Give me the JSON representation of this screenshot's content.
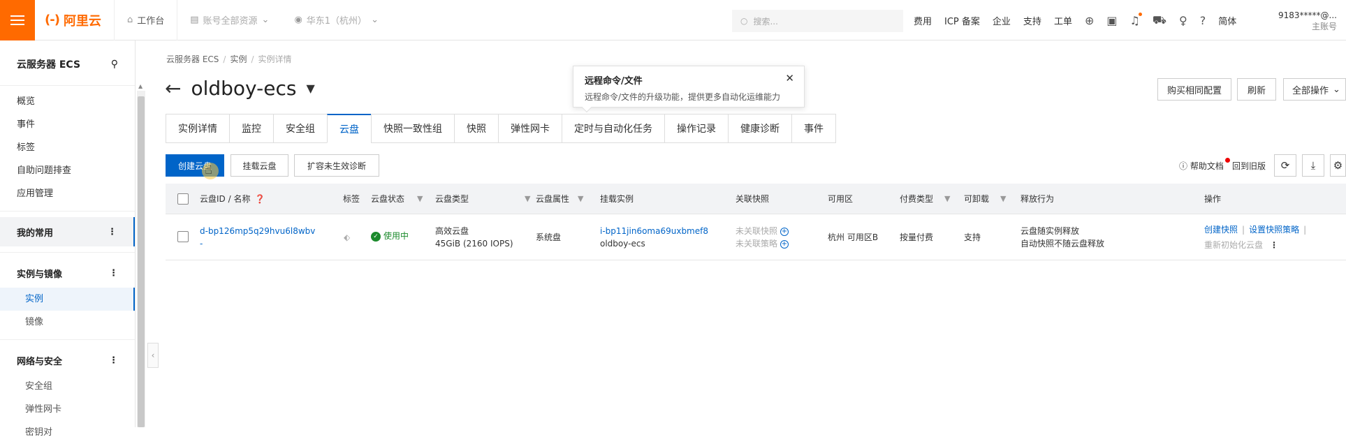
{
  "topbar": {
    "logo_text": "阿里云",
    "workbench": "工作台",
    "account_scope": "账号全部资源",
    "region": "华东1（杭州）",
    "search_placeholder": "搜索...",
    "nav": [
      "费用",
      "ICP 备案",
      "企业",
      "支持",
      "工单"
    ],
    "lang": "简体",
    "account_id": "9183*****@...",
    "account_role": "主账号"
  },
  "sidebar": {
    "title": "云服务器 ECS",
    "top_items": [
      "概览",
      "事件",
      "标签",
      "自助问题排查",
      "应用管理"
    ],
    "groups": [
      {
        "label": "我的常用",
        "items": []
      },
      {
        "label": "实例与镜像",
        "items": [
          "实例",
          "镜像"
        ]
      },
      {
        "label": "网络与安全",
        "items": [
          "安全组",
          "弹性网卡",
          "密钥对"
        ]
      }
    ]
  },
  "breadcrumb": [
    "云服务器 ECS",
    "实例",
    "实例详情"
  ],
  "page_title": "oldboy-ecs",
  "popover": {
    "title": "远程命令/文件",
    "desc": "远程命令/文件的升级功能，提供更多自动化运维能力"
  },
  "header_buttons": [
    "购买相同配置",
    "刷新",
    "全部操作"
  ],
  "tabs": [
    "实例详情",
    "监控",
    "安全组",
    "云盘",
    "快照一致性组",
    "快照",
    "弹性网卡",
    "定时与自动化任务",
    "操作记录",
    "健康诊断",
    "事件"
  ],
  "active_tab": "云盘",
  "actions": {
    "create_disk": "创建云盘",
    "attach_disk": "挂载云盘",
    "diagnose": "扩容未生效诊断",
    "help_doc": "帮助文档",
    "old_version": "回到旧版"
  },
  "table": {
    "headers": [
      "云盘ID / 名称",
      "标签",
      "云盘状态",
      "云盘类型",
      "云盘属性",
      "挂载实例",
      "关联快照",
      "可用区",
      "付费类型",
      "可卸载",
      "释放行为",
      "操作"
    ],
    "rows": [
      {
        "disk_id": "d-bp126mp5q29hvu6l8wbv",
        "disk_name": "-",
        "status": "使用中",
        "type": "高效云盘",
        "type_detail": "45GiB (2160 IOPS)",
        "attr": "系统盘",
        "instance_id": "i-bp11jin6oma69uxbmef8",
        "instance_name": "oldboy-ecs",
        "snapshot": "未关联快照",
        "snapshot_policy": "未关联策略",
        "zone": "杭州 可用区B",
        "billing": "按量付费",
        "detachable": "支持",
        "release1": "云盘随实例释放",
        "release2": "自动快照不随云盘释放",
        "op_snapshot": "创建快照",
        "op_policy": "设置快照策略",
        "op_reinit": "重新初始化云盘"
      }
    ]
  }
}
